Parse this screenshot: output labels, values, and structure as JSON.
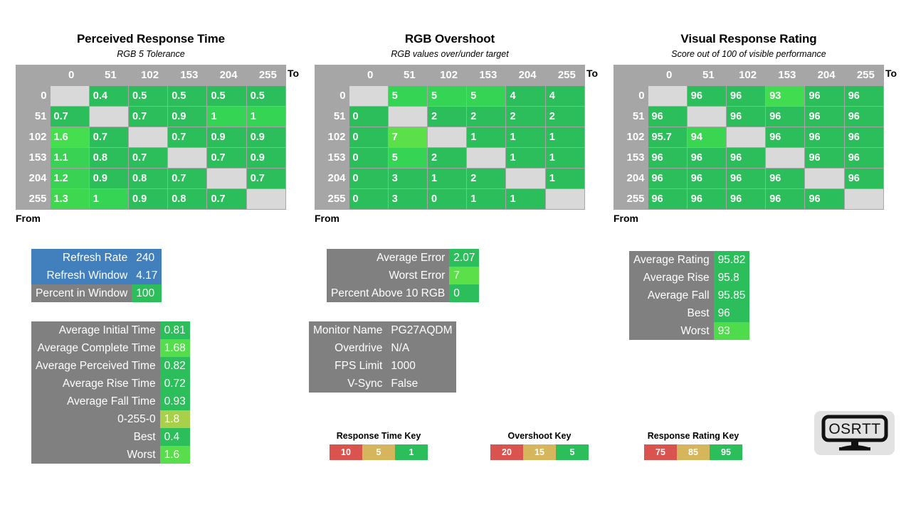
{
  "chart_data": [
    {
      "type": "heatmap",
      "title": "Perceived Response Time",
      "subtitle": "RGB 5 Tolerance",
      "xlabel": "To",
      "ylabel": "From",
      "categories": [
        "0",
        "51",
        "102",
        "153",
        "204",
        "255"
      ],
      "rows": [
        "0",
        "51",
        "102",
        "153",
        "204",
        "255"
      ],
      "values": [
        [
          null,
          "0.4",
          "0.5",
          "0.5",
          "0.5",
          "0.5"
        ],
        [
          "0.7",
          null,
          "0.7",
          "0.9",
          "1",
          "1"
        ],
        [
          "1.6",
          "0.7",
          null,
          "0.7",
          "0.9",
          "0.9"
        ],
        [
          "1.1",
          "0.8",
          "0.7",
          null,
          "0.7",
          "0.9"
        ],
        [
          "1.2",
          "0.9",
          "0.8",
          "0.7",
          null,
          "0.7"
        ],
        [
          "1.3",
          "1",
          "0.9",
          "0.8",
          "0.7",
          null
        ]
      ],
      "colors": [
        [
          null,
          "#2cbe5a",
          "#2cbe5a",
          "#2cbe5a",
          "#2cbe5a",
          "#2cbe5a"
        ],
        [
          "#2cbe5a",
          null,
          "#2cbe5a",
          "#2cbe5a",
          "#35d454",
          "#35d454"
        ],
        [
          "#45de4f",
          "#2cbe5a",
          null,
          "#2cbe5a",
          "#2cbe5a",
          "#2cbe5a"
        ],
        [
          "#3ad252",
          "#2cbe5a",
          "#2cbe5a",
          null,
          "#2cbe5a",
          "#2cbe5a"
        ],
        [
          "#3ad252",
          "#2cbe5a",
          "#2cbe5a",
          "#2cbe5a",
          null,
          "#2cbe5a"
        ],
        [
          "#3fd650",
          "#35d454",
          "#2cbe5a",
          "#2cbe5a",
          "#2cbe5a",
          null
        ]
      ]
    },
    {
      "type": "heatmap",
      "title": "RGB Overshoot",
      "subtitle": "RGB values over/under target",
      "xlabel": "To",
      "ylabel": "From",
      "categories": [
        "0",
        "51",
        "102",
        "153",
        "204",
        "255"
      ],
      "rows": [
        "0",
        "51",
        "102",
        "153",
        "204",
        "255"
      ],
      "values": [
        [
          null,
          "5",
          "5",
          "5",
          "4",
          "4"
        ],
        [
          "0",
          null,
          "2",
          "2",
          "2",
          "2"
        ],
        [
          "0",
          "7",
          null,
          "1",
          "1",
          "1"
        ],
        [
          "0",
          "5",
          "2",
          null,
          "1",
          "1"
        ],
        [
          "0",
          "3",
          "1",
          "2",
          null,
          "1"
        ],
        [
          "0",
          "3",
          "0",
          "1",
          "1",
          null
        ]
      ],
      "colors": [
        [
          null,
          "#35d454",
          "#35d454",
          "#35d454",
          "#2cbe5a",
          "#2cbe5a"
        ],
        [
          "#2cbe5a",
          null,
          "#2cbe5a",
          "#2cbe5a",
          "#2cbe5a",
          "#2cbe5a"
        ],
        [
          "#2cbe5a",
          "#5ce04a",
          null,
          "#2cbe5a",
          "#2cbe5a",
          "#2cbe5a"
        ],
        [
          "#2cbe5a",
          "#35d454",
          "#2cbe5a",
          null,
          "#2cbe5a",
          "#2cbe5a"
        ],
        [
          "#2cbe5a",
          "#2cbe5a",
          "#2cbe5a",
          "#2cbe5a",
          null,
          "#2cbe5a"
        ],
        [
          "#2cbe5a",
          "#2cbe5a",
          "#2cbe5a",
          "#2cbe5a",
          "#2cbe5a",
          null
        ]
      ]
    },
    {
      "type": "heatmap",
      "title": "Visual Response Rating",
      "subtitle": "Score out of 100 of visible performance",
      "xlabel": "To",
      "ylabel": "From",
      "categories": [
        "0",
        "51",
        "102",
        "153",
        "204",
        "255"
      ],
      "rows": [
        "0",
        "51",
        "102",
        "153",
        "204",
        "255"
      ],
      "values": [
        [
          null,
          "96",
          "96",
          "93",
          "96",
          "96"
        ],
        [
          "96",
          null,
          "96",
          "96",
          "96",
          "96"
        ],
        [
          "95.7",
          "94",
          null,
          "96",
          "96",
          "96"
        ],
        [
          "96",
          "96",
          "96",
          null,
          "96",
          "96"
        ],
        [
          "96",
          "96",
          "96",
          "96",
          null,
          "96"
        ],
        [
          "96",
          "96",
          "96",
          "96",
          "96",
          null
        ]
      ],
      "colors": [
        [
          null,
          "#2cbe5a",
          "#2cbe5a",
          "#42dc50",
          "#2cbe5a",
          "#2cbe5a"
        ],
        [
          "#2cbe5a",
          null,
          "#2cbe5a",
          "#2cbe5a",
          "#2cbe5a",
          "#2cbe5a"
        ],
        [
          "#2cbe5a",
          "#3ad652",
          null,
          "#2cbe5a",
          "#2cbe5a",
          "#2cbe5a"
        ],
        [
          "#2cbe5a",
          "#2cbe5a",
          "#2cbe5a",
          null,
          "#2cbe5a",
          "#2cbe5a"
        ],
        [
          "#2cbe5a",
          "#2cbe5a",
          "#2cbe5a",
          "#2cbe5a",
          null,
          "#2cbe5a"
        ],
        [
          "#2cbe5a",
          "#2cbe5a",
          "#2cbe5a",
          "#2cbe5a",
          "#2cbe5a",
          null
        ]
      ]
    }
  ],
  "panels": {
    "refresh": {
      "rows": [
        {
          "label": "Refresh Rate",
          "value": "240",
          "label_bg": "#4180bd",
          "value_bg": "#4180bd"
        },
        {
          "label": "Refresh Window",
          "value": "4.17",
          "label_bg": "#4180bd",
          "value_bg": "#4180bd"
        },
        {
          "label": "Percent in Window",
          "value": "100",
          "label_bg": "#808080",
          "value_bg": "#2cbe5a"
        }
      ]
    },
    "response_times": {
      "rows": [
        {
          "label": "Average Initial Time",
          "value": "0.81",
          "label_bg": "#808080",
          "value_bg": "#2cbe5a"
        },
        {
          "label": "Average Complete Time",
          "value": "1.68",
          "label_bg": "#808080",
          "value_bg": "#54dd4c"
        },
        {
          "label": "Average Perceived Time",
          "value": "0.82",
          "label_bg": "#808080",
          "value_bg": "#2cbe5a"
        },
        {
          "label": "Average Rise Time",
          "value": "0.72",
          "label_bg": "#808080",
          "value_bg": "#2cbe5a"
        },
        {
          "label": "Average Fall Time",
          "value": "0.93",
          "label_bg": "#808080",
          "value_bg": "#2cbe5a"
        },
        {
          "label": "0-255-0",
          "value": "1.8",
          "label_bg": "#808080",
          "value_bg": "#a8d04a"
        },
        {
          "label": "Best",
          "value": "0.4",
          "label_bg": "#808080",
          "value_bg": "#2cbe5a"
        },
        {
          "label": "Worst",
          "value": "1.6",
          "label_bg": "#808080",
          "value_bg": "#58de4b"
        }
      ]
    },
    "errors": {
      "rows": [
        {
          "label": "Average Error",
          "value": "2.07",
          "label_bg": "#808080",
          "value_bg": "#2cbe5a"
        },
        {
          "label": "Worst Error",
          "value": "7",
          "label_bg": "#808080",
          "value_bg": "#5ce04a"
        },
        {
          "label": "Percent Above 10 RGB",
          "value": "0",
          "label_bg": "#808080",
          "value_bg": "#2cbe5a"
        }
      ]
    },
    "monitor_info": {
      "rows": [
        {
          "label": "Monitor Name",
          "value": "PG27AQDM",
          "label_bg": "#808080",
          "value_bg": "#808080"
        },
        {
          "label": "Overdrive",
          "value": "N/A",
          "label_bg": "#808080",
          "value_bg": "#808080"
        },
        {
          "label": "FPS Limit",
          "value": "1000",
          "label_bg": "#808080",
          "value_bg": "#808080"
        },
        {
          "label": "V-Sync",
          "value": "False",
          "label_bg": "#808080",
          "value_bg": "#808080"
        }
      ]
    },
    "ratings": {
      "rows": [
        {
          "label": "Average Rating",
          "value": "95.82",
          "label_bg": "#808080",
          "value_bg": "#2cbe5a"
        },
        {
          "label": "Average Rise",
          "value": "95.8",
          "label_bg": "#808080",
          "value_bg": "#2cbe5a"
        },
        {
          "label": "Average Fall",
          "value": "95.85",
          "label_bg": "#808080",
          "value_bg": "#2cbe5a"
        },
        {
          "label": "Best",
          "value": "96",
          "label_bg": "#808080",
          "value_bg": "#2cbe5a"
        },
        {
          "label": "Worst",
          "value": "93",
          "label_bg": "#808080",
          "value_bg": "#4edc4d"
        }
      ]
    }
  },
  "keys": [
    {
      "title": "Response Time Key",
      "cells": [
        {
          "label": "10",
          "color": "#d9534f"
        },
        {
          "label": "5",
          "color": "#d6b65c"
        },
        {
          "label": "1",
          "color": "#2cbe5a"
        }
      ]
    },
    {
      "title": "Overshoot Key",
      "cells": [
        {
          "label": "20",
          "color": "#d9534f"
        },
        {
          "label": "15",
          "color": "#d6b65c"
        },
        {
          "label": "5",
          "color": "#2cbe5a"
        }
      ]
    },
    {
      "title": "Response Rating Key",
      "cells": [
        {
          "label": "75",
          "color": "#d9534f"
        },
        {
          "label": "85",
          "color": "#d6b65c"
        },
        {
          "label": "95",
          "color": "#2cbe5a"
        }
      ]
    }
  ],
  "logo": {
    "text": "OSRTT"
  }
}
